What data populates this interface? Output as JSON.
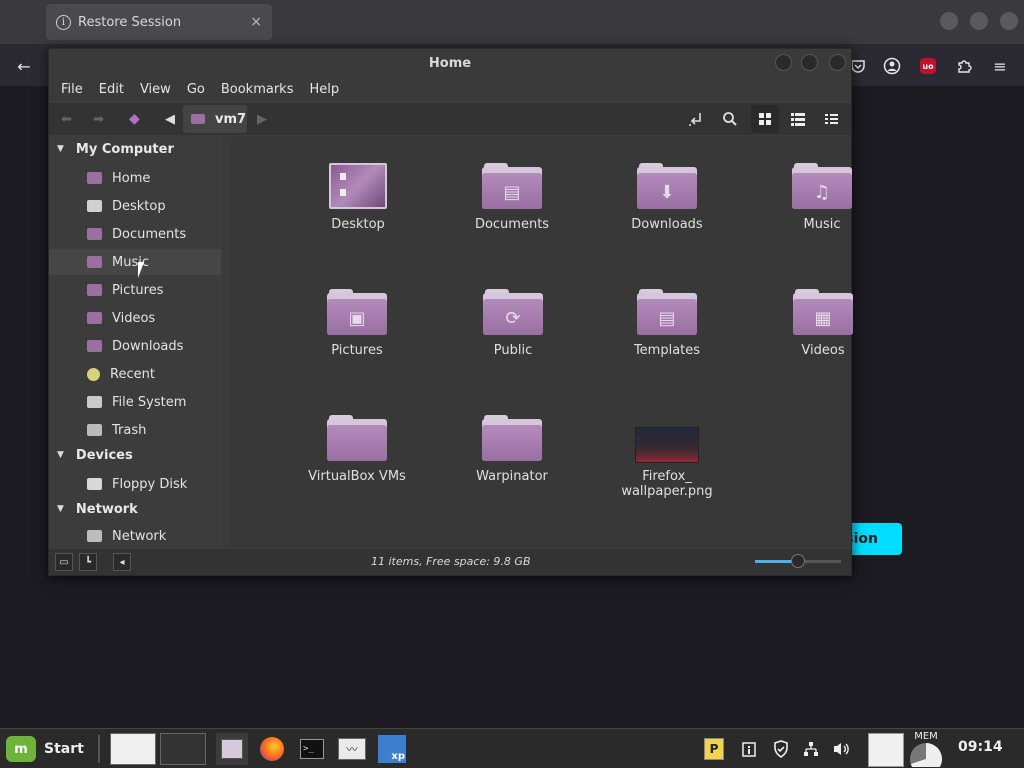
{
  "firefox": {
    "tab_title": "Restore Session",
    "tab_close": "×",
    "info_glyph": "i",
    "back_glyph": "←",
    "menu_glyph": "≡",
    "restore_button_partial": "sion"
  },
  "window": {
    "title": "Home"
  },
  "menubar": [
    "File",
    "Edit",
    "View",
    "Go",
    "Bookmarks",
    "Help"
  ],
  "toolbar": {
    "breadcrumb": "vm7"
  },
  "sidebar": {
    "sections": [
      {
        "label": "My Computer",
        "items": [
          "Home",
          "Desktop",
          "Documents",
          "Music",
          "Pictures",
          "Videos",
          "Downloads",
          "Recent",
          "File System",
          "Trash"
        ]
      },
      {
        "label": "Devices",
        "items": [
          "Floppy Disk"
        ]
      },
      {
        "label": "Network",
        "items": [
          "Network"
        ]
      }
    ],
    "hovered_item": "Music"
  },
  "files": [
    {
      "name": "Desktop",
      "kind": "desktop",
      "glyph": ""
    },
    {
      "name": "Documents",
      "kind": "folder",
      "glyph": "▤"
    },
    {
      "name": "Downloads",
      "kind": "folder",
      "glyph": "⬇"
    },
    {
      "name": "Music",
      "kind": "folder",
      "glyph": "♫"
    },
    {
      "name": "Pictures",
      "kind": "folder",
      "glyph": "▣"
    },
    {
      "name": "Public",
      "kind": "folder",
      "glyph": "⟳"
    },
    {
      "name": "Templates",
      "kind": "folder",
      "glyph": "▤"
    },
    {
      "name": "Videos",
      "kind": "folder",
      "glyph": "▦"
    },
    {
      "name": "VirtualBox VMs",
      "kind": "folder",
      "glyph": ""
    },
    {
      "name": "Warpinator",
      "kind": "folder",
      "glyph": ""
    },
    {
      "name": "Firefox_\nwallpaper.png",
      "kind": "image",
      "glyph": ""
    }
  ],
  "statusbar": {
    "text": "11 items, Free space: 9.8 GB",
    "zoom_level": 0.5
  },
  "taskbar": {
    "start_label": "Start",
    "start_logo": "m",
    "terminal_glyph": ">_",
    "monitor_glyph": "〰",
    "xp_label": "xp",
    "tray_p": "P",
    "mem_label": "MEM",
    "clock": "09:14"
  },
  "colors": {
    "folder_accent": "#9b6fa3",
    "restore_accent": "#00ddff",
    "zoom_accent": "#4fb0e8"
  }
}
